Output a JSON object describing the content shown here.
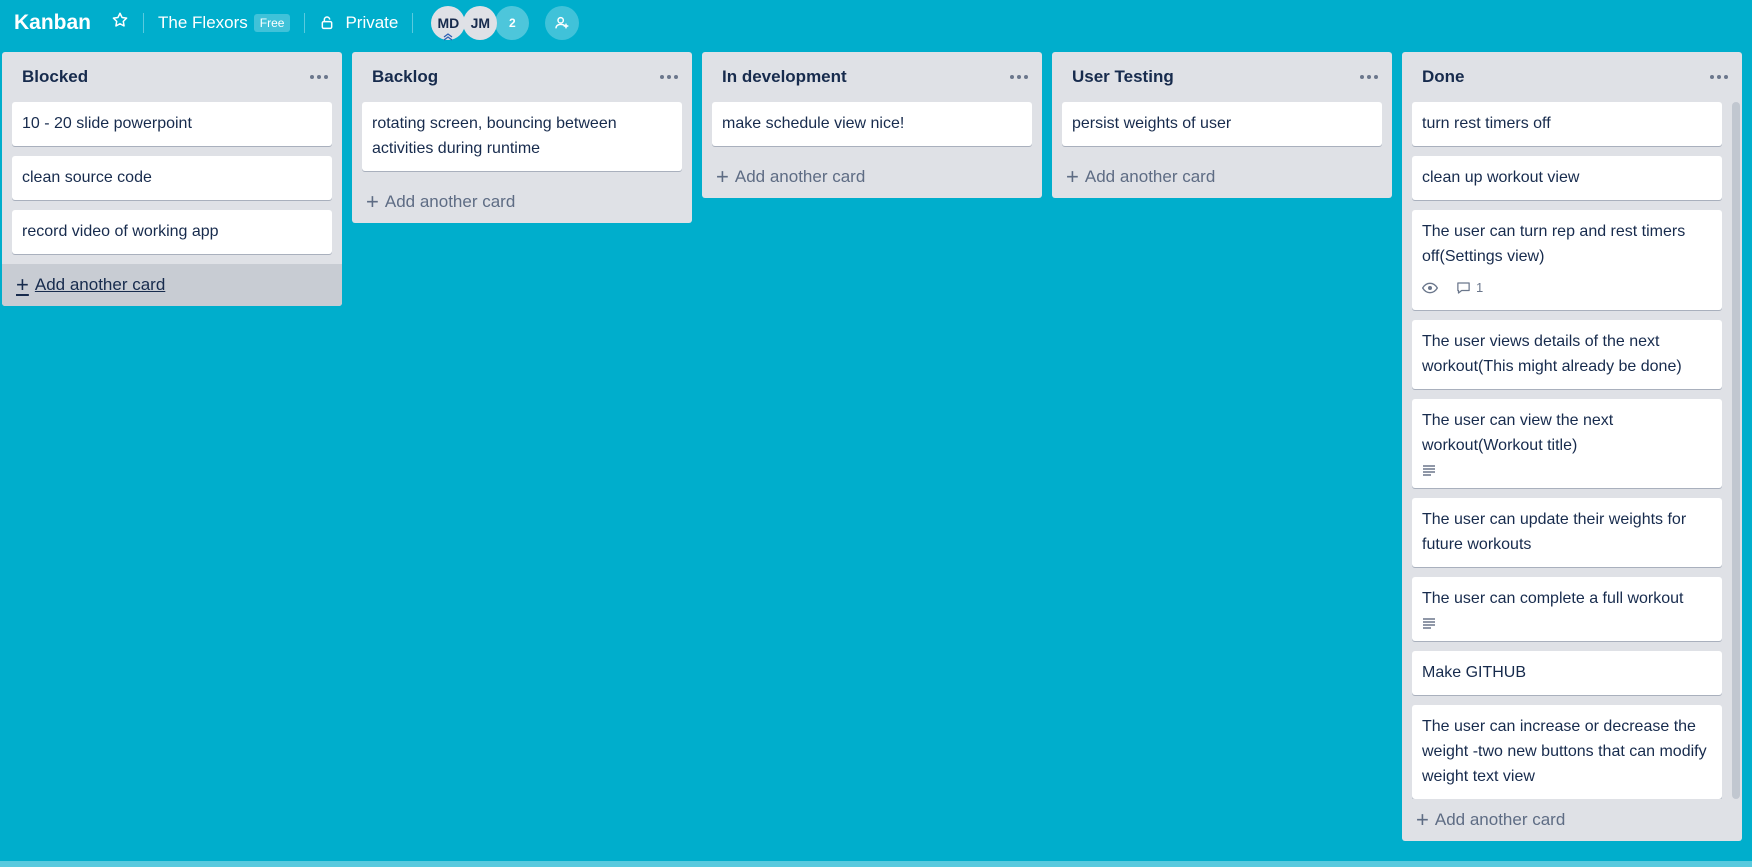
{
  "header": {
    "board_title": "Kanban",
    "team_name": "The Flexors",
    "team_badge": "Free",
    "visibility": "Private",
    "members": [
      {
        "initials": "MD",
        "admin": true
      },
      {
        "initials": "JM",
        "admin": false
      }
    ],
    "more_members_count": "2"
  },
  "lists": [
    {
      "title": "Blocked",
      "cards": [
        {
          "text": "10 - 20 slide powerpoint"
        },
        {
          "text": "clean source code"
        },
        {
          "text": "record video of working app"
        }
      ],
      "add_card_label": "Add another card"
    },
    {
      "title": "Backlog",
      "cards": [
        {
          "text": "rotating screen, bouncing between activities during runtime"
        }
      ],
      "add_card_label": "Add another card"
    },
    {
      "title": "In development",
      "cards": [
        {
          "text": "make schedule view nice!"
        }
      ],
      "add_card_label": "Add another card"
    },
    {
      "title": "User Testing",
      "cards": [
        {
          "text": "persist weights of user"
        }
      ],
      "add_card_label": "Add another card"
    },
    {
      "title": "Done",
      "cards": [
        {
          "text": "turn rest timers off"
        },
        {
          "text": "clean up workout view"
        },
        {
          "text": "The user can turn rep and rest timers off(Settings view)",
          "badges": {
            "watching": true,
            "comments": "1"
          }
        },
        {
          "text": "The user views details of the next workout(This might already be done)"
        },
        {
          "text": "The user can view the next workout(Workout title)",
          "badges": {
            "description": true
          }
        },
        {
          "text": "The user can update their weights for future workouts"
        },
        {
          "text": "The user can complete a full workout",
          "badges": {
            "description": true
          }
        },
        {
          "text": "Make GITHUB"
        },
        {
          "text": "The user can increase or decrease the weight -two new buttons that can modify weight text view"
        }
      ],
      "add_card_label": "Add another card"
    }
  ],
  "icons": {
    "star": "star-icon",
    "lock": "lock-icon",
    "invite": "add-member-icon",
    "eye": "eye-icon",
    "comment": "comment-icon",
    "description": "description-icon"
  },
  "colors": {
    "board_background": "#00AECC",
    "list_background": "#dfe1e6",
    "card_background": "#ffffff"
  }
}
